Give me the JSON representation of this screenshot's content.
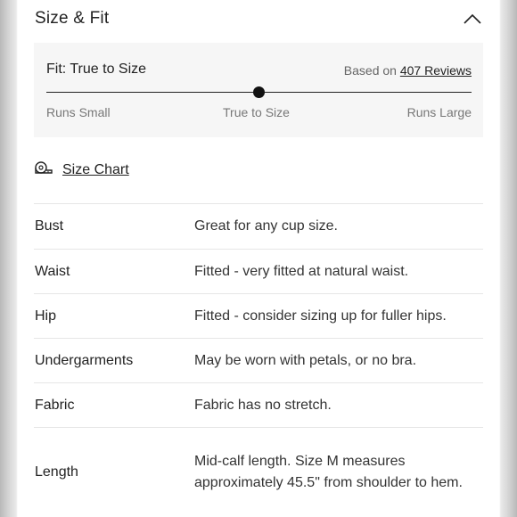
{
  "section": {
    "title": "Size & Fit"
  },
  "fit": {
    "label": "Fit: True to Size",
    "reviews_prefix": "Based on",
    "reviews_link": "407 Reviews",
    "scale_left": "Runs Small",
    "scale_mid": "True to Size",
    "scale_right": "Runs Large",
    "position": 0.5
  },
  "size_chart": {
    "label": "Size Chart",
    "icon": "measuring-tape-icon"
  },
  "details": [
    {
      "key": "Bust",
      "value": "Great for any cup size."
    },
    {
      "key": "Waist",
      "value": "Fitted - very fitted at natural waist."
    },
    {
      "key": "Hip",
      "value": "Fitted - consider sizing up for fuller hips."
    },
    {
      "key": "Undergarments",
      "value": "May be worn with petals, or no bra."
    },
    {
      "key": "Fabric",
      "value": "Fabric has no stretch."
    },
    {
      "key": "Length",
      "value": "Mid-calf length. Size M measures approximately 45.5\" from shoulder to hem."
    }
  ]
}
